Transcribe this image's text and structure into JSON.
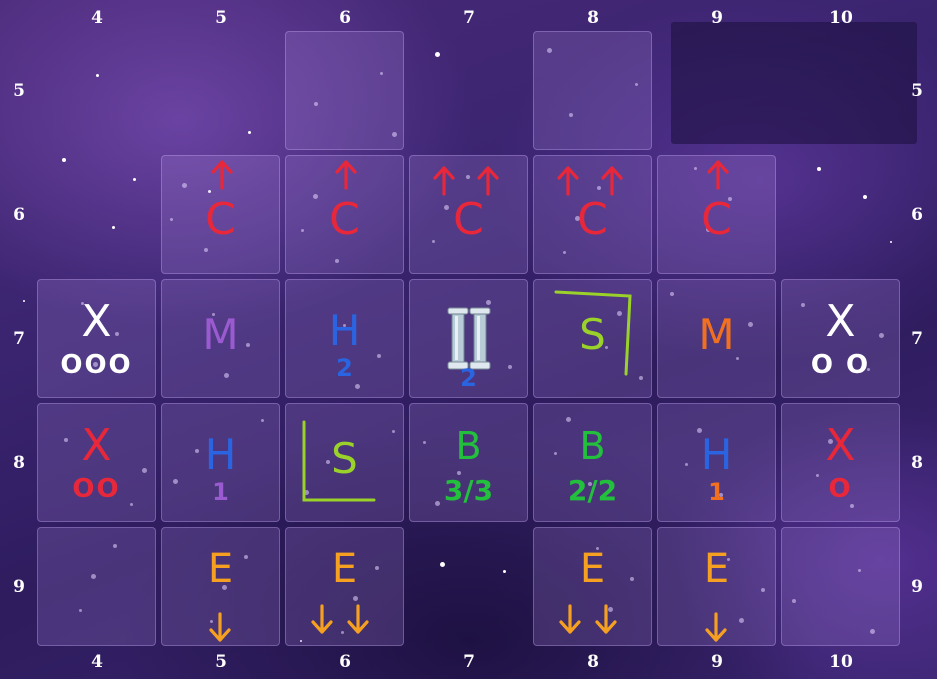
{
  "grid": {
    "col_labels": [
      "4",
      "5",
      "6",
      "7",
      "8",
      "9",
      "10"
    ],
    "row_labels": [
      "5",
      "6",
      "7",
      "8",
      "9"
    ]
  },
  "colors": {
    "red": "#e8283a",
    "white": "#ffffff",
    "purple": "#9a5ad0",
    "blue": "#2a64e0",
    "green": "#22c03c",
    "lime": "#9ad22a",
    "orange": "#f07020",
    "amber": "#f5a020",
    "silver": "#b8ccd8"
  },
  "tiles": [
    {
      "id": "r5c6",
      "col": "6",
      "row": "5",
      "symbol": "",
      "sub": "",
      "color": "",
      "arrows": ""
    },
    {
      "id": "r5c8",
      "col": "8",
      "row": "5",
      "symbol": "",
      "sub": "",
      "color": "",
      "arrows": ""
    },
    {
      "id": "r6c5",
      "col": "5",
      "row": "6",
      "symbol": "C",
      "sub": "",
      "color": "red",
      "arrows": "up1"
    },
    {
      "id": "r6c6",
      "col": "6",
      "row": "6",
      "symbol": "C",
      "sub": "",
      "color": "red",
      "arrows": "up1"
    },
    {
      "id": "r6c7",
      "col": "7",
      "row": "6",
      "symbol": "C",
      "sub": "",
      "color": "red",
      "arrows": "up2"
    },
    {
      "id": "r6c8",
      "col": "8",
      "row": "6",
      "symbol": "C",
      "sub": "",
      "color": "red",
      "arrows": "up2"
    },
    {
      "id": "r6c9",
      "col": "9",
      "row": "6",
      "symbol": "C",
      "sub": "",
      "color": "red",
      "arrows": "up1"
    },
    {
      "id": "r7c4",
      "col": "4",
      "row": "7",
      "symbol": "X",
      "sub": "OOO",
      "color": "white",
      "arrows": ""
    },
    {
      "id": "r7c5",
      "col": "5",
      "row": "7",
      "symbol": "M",
      "sub": "",
      "color": "purple",
      "arrows": ""
    },
    {
      "id": "r7c6",
      "col": "6",
      "row": "7",
      "symbol": "H",
      "sub": "2",
      "color": "blue",
      "arrows": ""
    },
    {
      "id": "r7c7",
      "col": "7",
      "row": "7",
      "symbol": "",
      "sub": "2",
      "color": "blue",
      "arrows": "",
      "pillars": true
    },
    {
      "id": "r7c8",
      "col": "8",
      "row": "7",
      "symbol": "S",
      "sub": "",
      "color": "lime",
      "arrows": "",
      "bracket": "top-right"
    },
    {
      "id": "r7c9",
      "col": "9",
      "row": "7",
      "symbol": "M",
      "sub": "",
      "color": "orange",
      "arrows": ""
    },
    {
      "id": "r7c10",
      "col": "10",
      "row": "7",
      "symbol": "X",
      "sub": "O O",
      "color": "white",
      "arrows": ""
    },
    {
      "id": "r8c4",
      "col": "4",
      "row": "8",
      "symbol": "X",
      "sub": "OO",
      "color": "red",
      "arrows": ""
    },
    {
      "id": "r8c5",
      "col": "5",
      "row": "8",
      "symbol": "H",
      "sub": "1",
      "color": "blue",
      "subcolor": "purple",
      "arrows": ""
    },
    {
      "id": "r8c6",
      "col": "6",
      "row": "8",
      "symbol": "S",
      "sub": "",
      "color": "lime",
      "arrows": "",
      "bracket": "bottom-left"
    },
    {
      "id": "r8c7",
      "col": "7",
      "row": "8",
      "symbol": "B",
      "sub": "3/3",
      "color": "green",
      "arrows": ""
    },
    {
      "id": "r8c8",
      "col": "8",
      "row": "8",
      "symbol": "B",
      "sub": "2/2",
      "color": "green",
      "arrows": ""
    },
    {
      "id": "r8c9",
      "col": "9",
      "row": "8",
      "symbol": "H",
      "sub": "1",
      "color": "blue",
      "subcolor": "orange",
      "arrows": ""
    },
    {
      "id": "r8c10",
      "col": "10",
      "row": "8",
      "symbol": "X",
      "sub": "O",
      "color": "red",
      "arrows": ""
    },
    {
      "id": "r9c4",
      "col": "4",
      "row": "9",
      "symbol": "",
      "sub": "",
      "color": "",
      "arrows": ""
    },
    {
      "id": "r9c5",
      "col": "5",
      "row": "9",
      "symbol": "E",
      "sub": "",
      "color": "amber",
      "arrows": "down1"
    },
    {
      "id": "r9c6",
      "col": "6",
      "row": "9",
      "symbol": "E",
      "sub": "",
      "color": "amber",
      "arrows": "down2"
    },
    {
      "id": "r9c8",
      "col": "8",
      "row": "9",
      "symbol": "E",
      "sub": "",
      "color": "amber",
      "arrows": "down2"
    },
    {
      "id": "r9c9",
      "col": "9",
      "row": "9",
      "symbol": "E",
      "sub": "",
      "color": "amber",
      "arrows": "down1"
    },
    {
      "id": "r9c10",
      "col": "10",
      "row": "9",
      "symbol": "",
      "sub": "",
      "color": "",
      "arrows": ""
    }
  ]
}
